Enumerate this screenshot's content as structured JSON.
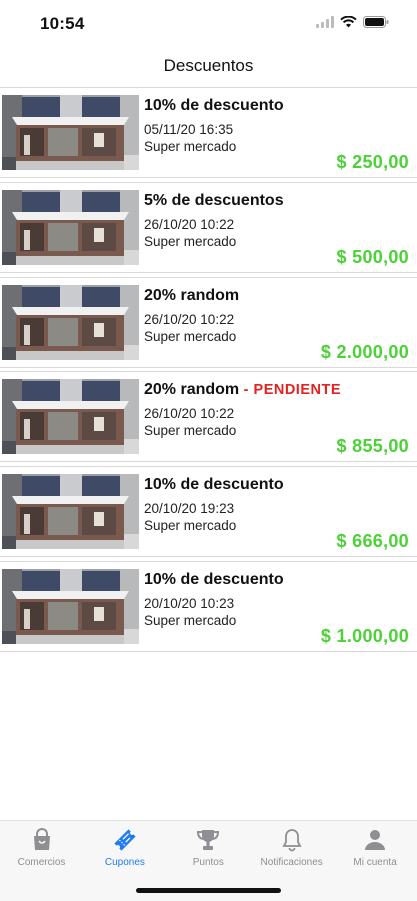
{
  "status_bar": {
    "time": "10:54"
  },
  "nav": {
    "title": "Descuentos"
  },
  "coupons": [
    {
      "title": "10% de descuento",
      "date": "05/11/20 16:35",
      "store": "Super mercado",
      "amount": "$ 250,00",
      "status": ""
    },
    {
      "title": "5% de descuentos",
      "date": "26/10/20 10:22",
      "store": "Super mercado",
      "amount": "$ 500,00",
      "status": ""
    },
    {
      "title": "20% random",
      "date": "26/10/20 10:22",
      "store": "Super mercado",
      "amount": "$ 2.000,00",
      "status": ""
    },
    {
      "title": "20% random",
      "date": "26/10/20 10:22",
      "store": "Super mercado",
      "amount": "$ 855,00",
      "status": " - PENDIENTE"
    },
    {
      "title": "10% de descuento",
      "date": "20/10/20 19:23",
      "store": "Super mercado",
      "amount": "$ 666,00",
      "status": ""
    },
    {
      "title": "10% de descuento",
      "date": "20/10/20 10:23",
      "store": "Super mercado",
      "amount": "$ 1.000,00",
      "status": ""
    }
  ],
  "tabs": [
    {
      "label": "Comercios",
      "icon": "shopping-bag-icon",
      "active": false
    },
    {
      "label": "Cupones",
      "icon": "ticket-icon",
      "active": true
    },
    {
      "label": "Puntos",
      "icon": "trophy-icon",
      "active": false
    },
    {
      "label": "Notificaciones",
      "icon": "bell-icon",
      "active": false
    },
    {
      "label": "Mi cuenta",
      "icon": "user-icon",
      "active": false
    }
  ],
  "colors": {
    "accent": "#1e7cf2",
    "amount": "#4cd137",
    "pending": "#e52222",
    "tab_inactive": "#8e8e93"
  }
}
